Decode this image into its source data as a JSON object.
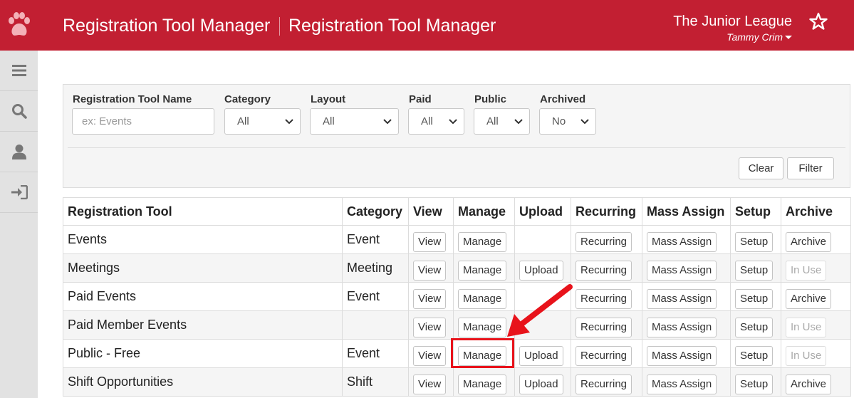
{
  "header": {
    "title": "Registration Tool Manager",
    "subtitle": "Registration Tool Manager",
    "organization": "The Junior League",
    "user": "Tammy Crim",
    "brand_color": "#c21f32"
  },
  "sidebar": {
    "items": [
      {
        "icon": "hamburger-menu-icon"
      },
      {
        "icon": "search-icon"
      },
      {
        "icon": "user-icon"
      },
      {
        "icon": "sign-in-icon"
      }
    ]
  },
  "filters": {
    "name_label": "Registration Tool Name",
    "name_placeholder": "ex: Events",
    "category_label": "Category",
    "category_value": "All",
    "layout_label": "Layout",
    "layout_value": "All",
    "paid_label": "Paid",
    "paid_value": "All",
    "public_label": "Public",
    "public_value": "All",
    "archived_label": "Archived",
    "archived_value": "No",
    "clear_label": "Clear",
    "filter_label": "Filter"
  },
  "table": {
    "headers": [
      "Registration Tool",
      "Category",
      "View",
      "Manage",
      "Upload",
      "Recurring",
      "Mass Assign",
      "Setup",
      "Archive"
    ],
    "rows": [
      {
        "name": "Events",
        "category": "Event",
        "view": "View",
        "manage": "Manage",
        "upload": "",
        "recurring": "Recurring",
        "mass_assign": "Mass Assign",
        "setup": "Setup",
        "archive": "Archive",
        "archive_disabled": false
      },
      {
        "name": "Meetings",
        "category": "Meeting",
        "view": "View",
        "manage": "Manage",
        "upload": "Upload",
        "recurring": "Recurring",
        "mass_assign": "Mass Assign",
        "setup": "Setup",
        "archive": "In Use",
        "archive_disabled": true
      },
      {
        "name": "Paid Events",
        "category": "Event",
        "view": "View",
        "manage": "Manage",
        "upload": "",
        "recurring": "Recurring",
        "mass_assign": "Mass Assign",
        "setup": "Setup",
        "archive": "Archive",
        "archive_disabled": false
      },
      {
        "name": "Paid Member Events",
        "category": "",
        "view": "View",
        "manage": "Manage",
        "upload": "",
        "recurring": "Recurring",
        "mass_assign": "Mass Assign",
        "setup": "Setup",
        "archive": "In Use",
        "archive_disabled": true
      },
      {
        "name": "Public - Free",
        "category": "Event",
        "view": "View",
        "manage": "Manage",
        "upload": "Upload",
        "recurring": "Recurring",
        "mass_assign": "Mass Assign",
        "setup": "Setup",
        "archive": "In Use",
        "archive_disabled": true
      },
      {
        "name": "Shift Opportunities",
        "category": "Shift",
        "view": "View",
        "manage": "Manage",
        "upload": "Upload",
        "recurring": "Recurring",
        "mass_assign": "Mass Assign",
        "setup": "Setup",
        "archive": "Archive",
        "archive_disabled": false
      }
    ]
  },
  "annotation": {
    "color": "#e8131b"
  }
}
